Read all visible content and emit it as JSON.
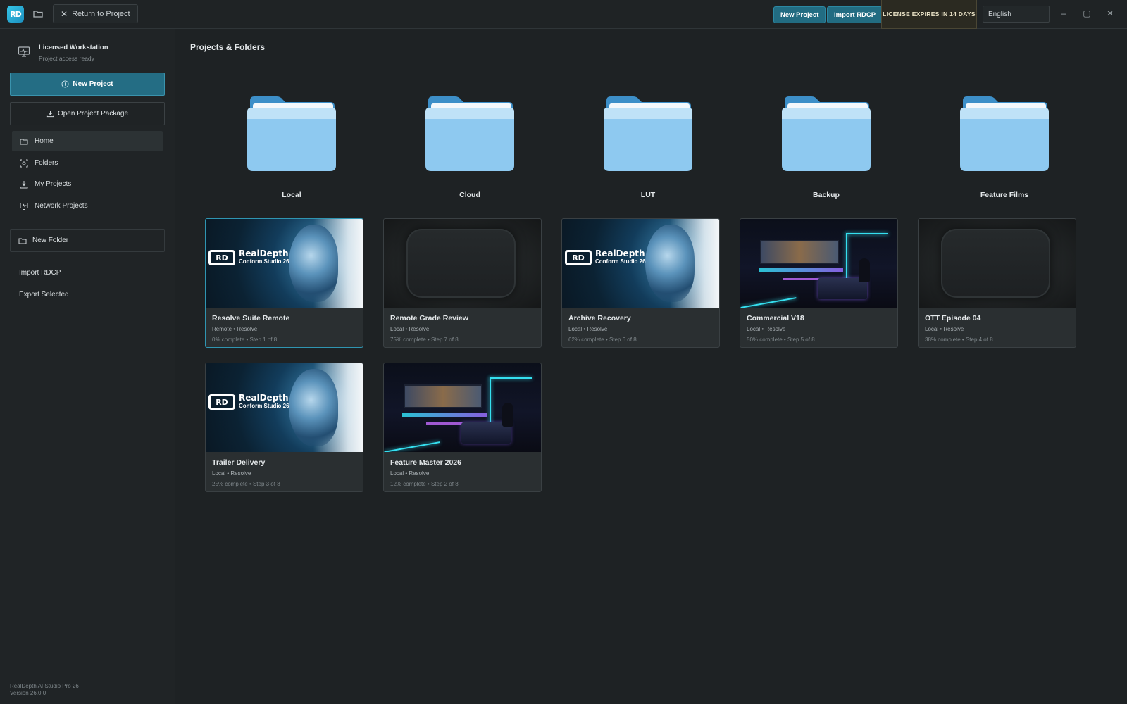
{
  "app": {
    "logo_text": "RD",
    "return_label": "Return to Project",
    "new_project_label": "New Project",
    "import_label": "Import RDCP",
    "license_text": "LICENSE EXPIRES IN 14 DAYS",
    "language": "English",
    "minimize": "–",
    "maximize": "▢",
    "close": "✕"
  },
  "sidebar": {
    "workstation_title": "Licensed Workstation",
    "workstation_subtitle": "Project access ready",
    "new_project": "New Project",
    "open_package": "Open Project Package",
    "nav": [
      {
        "label": "Home",
        "icon": "folder-open-icon",
        "active": true
      },
      {
        "label": "Folders",
        "icon": "folders-icon",
        "active": false
      },
      {
        "label": "My Projects",
        "icon": "download-icon",
        "active": false
      },
      {
        "label": "Network Projects",
        "icon": "network-icon",
        "active": false
      }
    ],
    "new_folder": "New Folder",
    "import_rdcp": "Import RDCP",
    "export_selected": "Export Selected",
    "version_line1": "RealDepth AI Studio Pro 26",
    "version_line2": "Version 26.0.0"
  },
  "main": {
    "title": "Projects & Folders",
    "folders": [
      "Local",
      "Cloud",
      "LUT",
      "Backup",
      "Feature Films"
    ],
    "brand_title": "RealDepth",
    "brand_subtitle": "Conform Studio 26",
    "projects": [
      {
        "name": "Resolve Suite Remote",
        "meta": "Remote • Resolve",
        "progress": "0% complete • Step 1 of 8",
        "thumb": "brand",
        "selected": true
      },
      {
        "name": "Remote Grade Review",
        "meta": "Local • Resolve",
        "progress": "75% complete • Step 7 of 8",
        "thumb": "dark",
        "selected": false
      },
      {
        "name": "Archive Recovery",
        "meta": "Local • Resolve",
        "progress": "62% complete • Step 6 of 8",
        "thumb": "brand",
        "selected": false
      },
      {
        "name": "Commercial V18",
        "meta": "Local • Resolve",
        "progress": "50% complete • Step 5 of 8",
        "thumb": "studio",
        "selected": false
      },
      {
        "name": "OTT Episode 04",
        "meta": "Local • Resolve",
        "progress": "38% complete • Step 4 of 8",
        "thumb": "dark",
        "selected": false
      },
      {
        "name": "Trailer Delivery",
        "meta": "Local • Resolve",
        "progress": "25% complete • Step 3 of 8",
        "thumb": "brand",
        "selected": false
      },
      {
        "name": "Feature Master 2026",
        "meta": "Local • Resolve",
        "progress": "12% complete • Step 2 of 8",
        "thumb": "studio",
        "selected": false
      }
    ]
  },
  "colors": {
    "accent": "#246d84",
    "folder_blue": "#8ec9f0",
    "folder_tab": "#3d8fc8"
  }
}
